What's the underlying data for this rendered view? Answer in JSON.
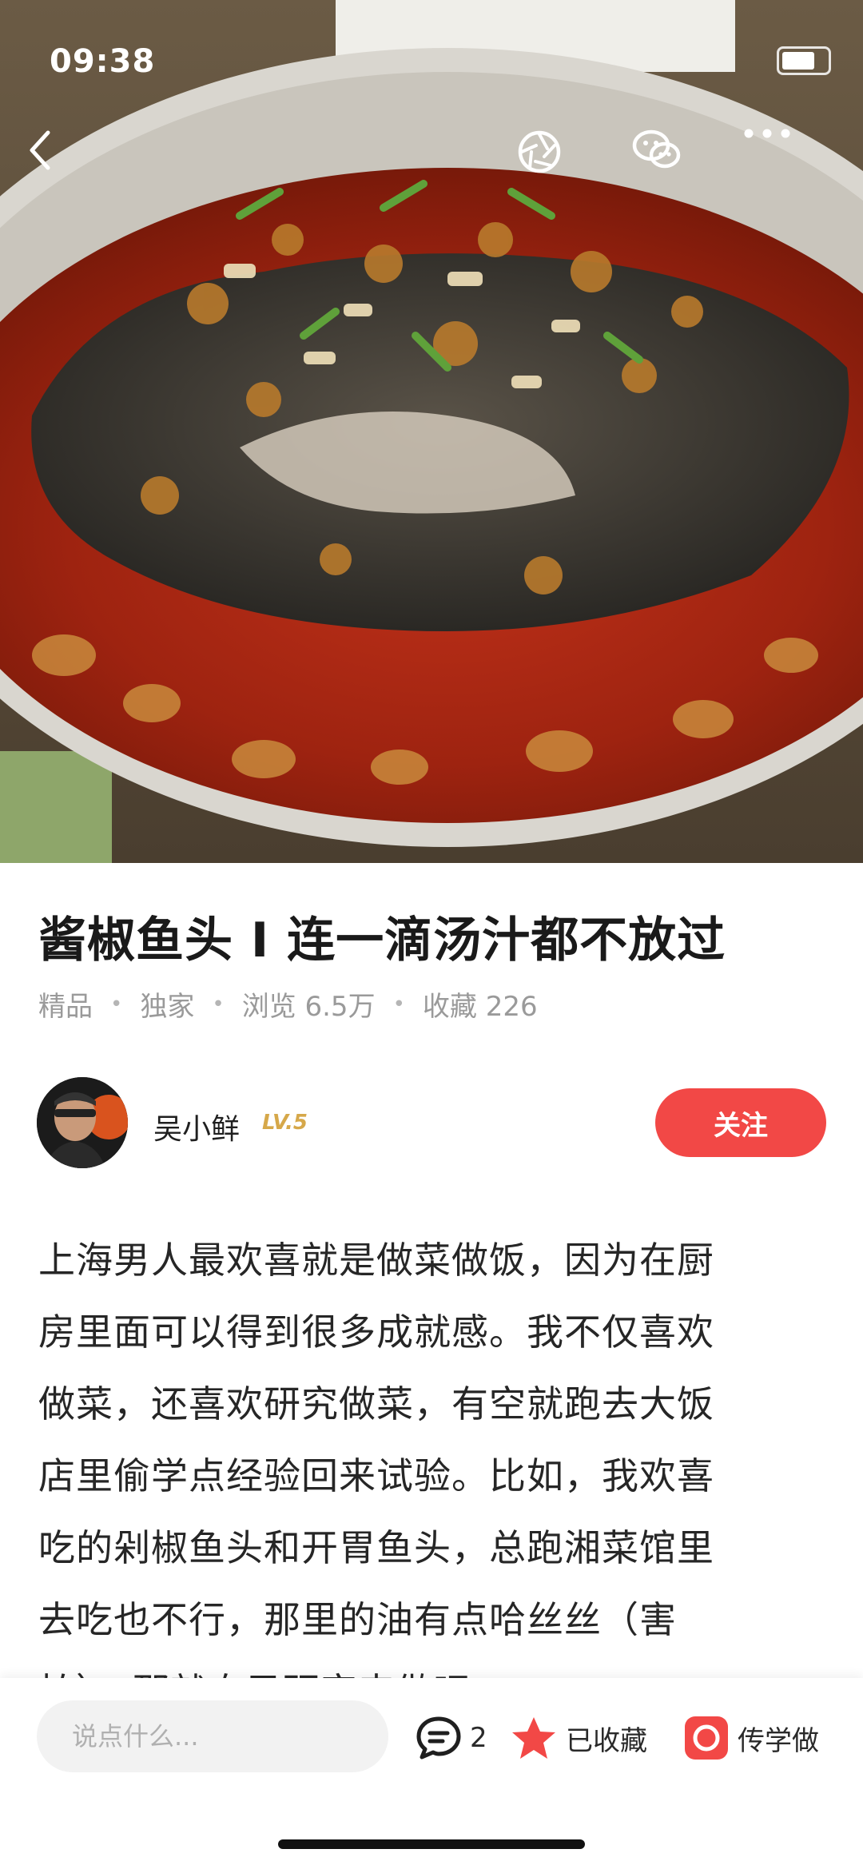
{
  "status_bar": {
    "time": "09:38"
  },
  "recipe": {
    "title": "酱椒鱼头 I 连一滴汤汁都不放过",
    "meta": [
      "精品",
      "独家",
      "浏览 6.5万",
      "收藏 226"
    ]
  },
  "author": {
    "name": "吴小鲜",
    "level": "LV.5",
    "follow_label": "关注"
  },
  "body": {
    "lines": [
      "上海男人最欢喜就是做菜做饭，因为在厨",
      "房里面可以得到很多成就感。我不仅喜欢",
      "做菜，还喜欢研究做菜，有空就跑去大饭",
      "店里偷学点经验回来试验。比如，我欢喜",
      "吃的剁椒鱼头和开胃鱼头，总跑湘菜馆里",
      "去吃也不行，那里的油有点哈丝丝（害",
      "怕），那就自己研究来做吧。"
    ]
  },
  "bottom_bar": {
    "comment_placeholder": "说点什么...",
    "comment_count": "2",
    "collected_label": "已收藏",
    "cook_label": "传学做"
  },
  "colors": {
    "accent_red": "#f24846",
    "level_gold": "#d6a84a",
    "meta_gray": "#9a9a9a"
  },
  "icons": [
    "back-icon",
    "shutter-icon",
    "wechat-icon",
    "more-icon",
    "comment-icon",
    "star-icon",
    "camera-icon"
  ]
}
